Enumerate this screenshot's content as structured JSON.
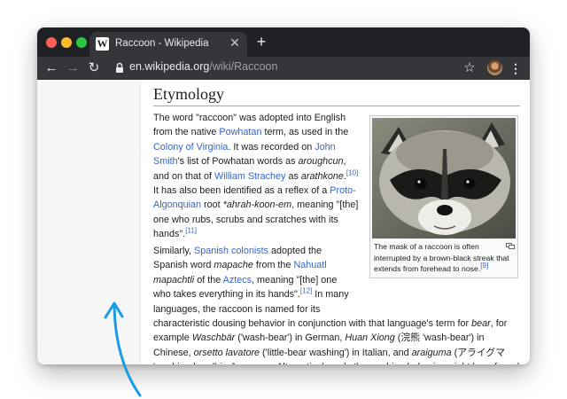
{
  "browser": {
    "tab_title": "Raccoon - Wikipedia",
    "favicon": "W",
    "url_domain": "en.wikipedia.org",
    "url_path": "/wiki/Raccoon",
    "icons": [
      "back-icon",
      "forward-icon",
      "reload-icon",
      "lock-icon",
      "star-icon",
      "menu-icon",
      "close-icon",
      "plus-icon"
    ]
  },
  "article": {
    "heading": "Etymology",
    "p1": {
      "t1": "The word \"raccoon\" was adopted into English from the native ",
      "l1": "Powhatan",
      "t2": " term, as used in the ",
      "l2": "Colony of Virginia",
      "t3": ". It was recorded on ",
      "l3": "John Smith",
      "t4": "'s list of Powhatan words as ",
      "i1": "aroughcun",
      "t5": ", and on that of ",
      "l4": "William Strachey",
      "t6": " as ",
      "i2": "arathkone",
      "t7": ".",
      "c1": "[10]",
      "t8": " It has also been identified as a reflex of a ",
      "l5": "Proto-Algonquian",
      "t9": " root ",
      "i3": "*ahrah-koon-em",
      "t10": ", meaning \"[the] one who rubs, scrubs and scratches with its hands\".",
      "c2": "[11]"
    },
    "p2": {
      "t1": "Similarly, ",
      "l1": "Spanish colonists",
      "t2": " adopted the Spanish word ",
      "i1": "mapache",
      "t3": " from the ",
      "l2": "Nahuatl",
      "t4": " ",
      "i2": "mapachtli",
      "t5": " of the ",
      "l3": "Aztecs",
      "t6": ", meaning \"[the] one who takes everything in its hands\".",
      "c1": "[12]",
      "t7": " In many languages, the raccoon is named for its characteristic dousing behavior in conjunction with that language's term for ",
      "i3": "bear",
      "t8": ", for example ",
      "i4": "Waschbär",
      "t9": " ('wash-bear') in German, ",
      "i5": "Huan Xiong",
      "t10": " (浣熊 'wash-bear') in Chinese, ",
      "i6": "orsetto lavatore",
      "t11": " ('little-bear washing') in Italian, and ",
      "i7": "araiguma",
      "t12": " (アライグマ 'washing-bear') in Japanese. Alternatively, only the washing behavior might be referred to, as in Russian (полоскун, poloskun) \"rinser\"."
    },
    "figure": {
      "caption": "The mask of a raccoon is often interrupted by a brown-black streak that extends from forehead to nose.",
      "cite": "[9]"
    }
  },
  "colors": {
    "link": "#3366cc",
    "tabbar": "#202124",
    "toolbar": "#35363a",
    "arrow": "#1a9be6"
  }
}
